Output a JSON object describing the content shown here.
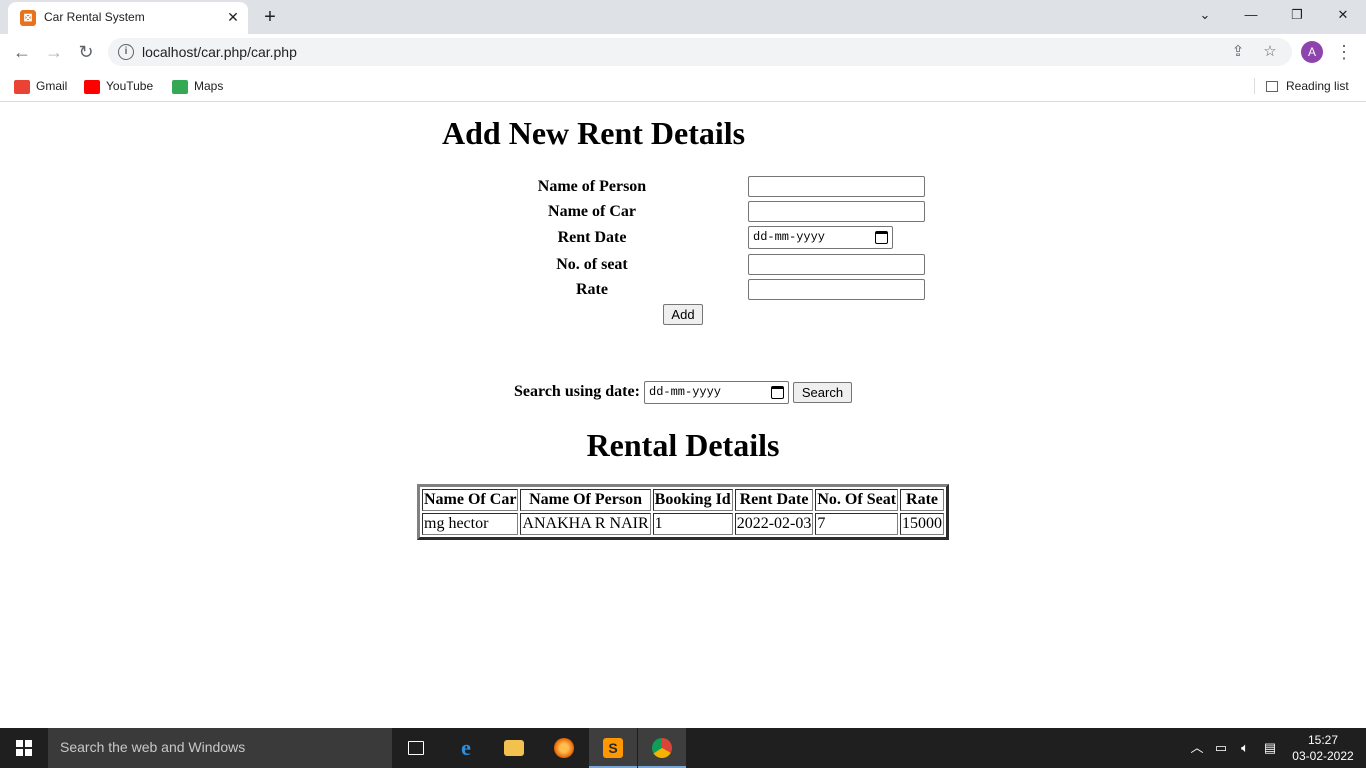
{
  "browser": {
    "tab_title": "Car Rental System",
    "tab_close": "✕",
    "new_tab": "+",
    "url": "localhost/car.php/car.php",
    "bookmarks": [
      {
        "label": "Gmail",
        "icon": "gmail-icon",
        "color": "#ea4335"
      },
      {
        "label": "YouTube",
        "icon": "youtube-icon",
        "color": "#ff0000"
      },
      {
        "label": "Maps",
        "icon": "maps-icon",
        "color": "#34a853"
      }
    ],
    "reading_list": "Reading list",
    "avatar_letter": "A",
    "window_controls": {
      "dropdown": "⌄",
      "minimize": "—",
      "restore": "❐",
      "close": "✕"
    }
  },
  "form": {
    "title": "Add New Rent Details",
    "fields": {
      "person": {
        "label": "Name of Person",
        "value": ""
      },
      "car": {
        "label": "Name of Car",
        "value": ""
      },
      "rent_date": {
        "label": "Rent Date",
        "placeholder": "dd-mm-yyyy"
      },
      "seats": {
        "label": "No. of seat",
        "value": ""
      },
      "rate": {
        "label": "Rate",
        "value": ""
      }
    },
    "add_button": "Add"
  },
  "search": {
    "label": "Search using date:",
    "placeholder": "dd-mm-yyyy",
    "button": "Search"
  },
  "rentals": {
    "title": "Rental Details",
    "columns": [
      "Name Of Car",
      "Name Of Person",
      "Booking Id",
      "Rent Date",
      "No. Of Seat",
      "Rate"
    ],
    "rows": [
      [
        "mg hector",
        "ANAKHA R NAIR",
        "1",
        "2022-02-03",
        "7",
        "15000"
      ]
    ]
  },
  "taskbar": {
    "search_placeholder": "Search the web and Windows",
    "apps": [
      {
        "name": "task-view-icon",
        "glyph": "▭",
        "color": "#1f1f1f"
      },
      {
        "name": "edge-icon",
        "glyph": "e",
        "color": "#0078d7"
      },
      {
        "name": "file-explorer-icon",
        "glyph": "▆",
        "color": "#f2c14e"
      },
      {
        "name": "firefox-icon",
        "glyph": "◉",
        "color": "#e66000"
      },
      {
        "name": "sublime-text-icon",
        "glyph": "S",
        "color": "#ff9800"
      },
      {
        "name": "chrome-icon",
        "glyph": "◎",
        "color": "#db4437"
      }
    ],
    "time": "15:27",
    "date": "03-02-2022"
  }
}
